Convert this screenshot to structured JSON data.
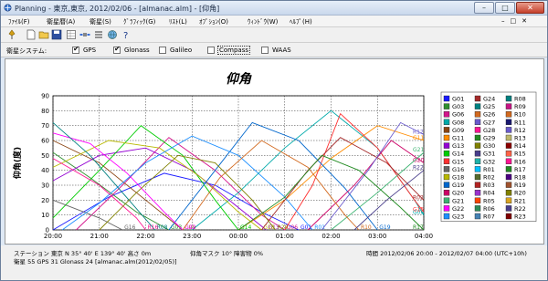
{
  "window": {
    "title": "Planning - 東京,東京, 2012/02/06 - [almanac.alm] - [仰角]",
    "min_label": "–",
    "max_label": "□",
    "close_label": "✕"
  },
  "menu": [
    "ﾌｧｲﾙ(F)",
    "衛星暦(A)",
    "衛星(S)",
    "ｸﾞﾗﾌｨｯｸ(G)",
    "ﾘｽﾄ(L)",
    "ｵﾌﾟｼｮﾝ(O)",
    "ｳｨﾝﾄﾞｳ(W)",
    "ﾍﾙﾌﾟ(H)"
  ],
  "toolbar_icons": [
    "pin-icon",
    "new-file-icon",
    "open-folder-icon",
    "save-icon",
    "sheet-icon",
    "satellite-icon",
    "list-icon",
    "globe-icon",
    "help-icon"
  ],
  "satellite_bar": {
    "label": "衛星システム:",
    "options": [
      {
        "name": "GPS",
        "checked": true
      },
      {
        "name": "Glonass",
        "checked": true
      },
      {
        "name": "Galileo",
        "checked": false
      },
      {
        "name": "Compass",
        "checked": false
      },
      {
        "name": "WAAS",
        "checked": false
      }
    ]
  },
  "chart_data": {
    "type": "line",
    "title": "仰角",
    "ylabel": "仰角(度)",
    "xlabel": "",
    "ylim": [
      0,
      90
    ],
    "yticks": [
      0,
      10,
      20,
      30,
      40,
      50,
      60,
      70,
      80,
      90
    ],
    "xticks": [
      "20:00",
      "21:00",
      "22:00",
      "23:00",
      "00:00",
      "01:00",
      "02:00",
      "03:00",
      "04:00"
    ],
    "grid": true,
    "legend_position": "right",
    "series": [
      {
        "name": "G01",
        "color": "#1a1aff",
        "points": [
          [
            0,
            0
          ],
          [
            1.2,
            22
          ],
          [
            2.4,
            38
          ],
          [
            3.5,
            30
          ],
          [
            4.5,
            12
          ],
          [
            5.3,
            0
          ]
        ]
      },
      {
        "name": "G03",
        "color": "#2f8f2f",
        "points": [
          [
            0,
            52
          ],
          [
            0.8,
            35
          ],
          [
            1.8,
            12
          ],
          [
            2.5,
            0
          ]
        ]
      },
      {
        "name": "G06",
        "color": "#d4148c",
        "points": [
          [
            0.5,
            0
          ],
          [
            1.5,
            30
          ],
          [
            2.5,
            62
          ],
          [
            3.5,
            40
          ],
          [
            4.5,
            10
          ],
          [
            5,
            0
          ]
        ]
      },
      {
        "name": "G08",
        "color": "#00aaaa",
        "points": [
          [
            3,
            0
          ],
          [
            4,
            25
          ],
          [
            5,
            55
          ],
          [
            6,
            80
          ],
          [
            7,
            55
          ],
          [
            7.8,
            20
          ],
          [
            8,
            10
          ]
        ]
      },
      {
        "name": "G09",
        "color": "#8b4513",
        "points": [
          [
            0,
            60
          ],
          [
            1,
            45
          ],
          [
            2,
            20
          ],
          [
            2.8,
            0
          ]
        ]
      },
      {
        "name": "G11",
        "color": "#ff8c00",
        "points": [
          [
            4,
            0
          ],
          [
            5,
            20
          ],
          [
            6,
            48
          ],
          [
            7,
            70
          ],
          [
            8,
            60
          ]
        ]
      },
      {
        "name": "G13",
        "color": "#9400d3",
        "points": [
          [
            0,
            33
          ],
          [
            1,
            50
          ],
          [
            2,
            55
          ],
          [
            3,
            40
          ],
          [
            4,
            15
          ],
          [
            4.6,
            0
          ]
        ]
      },
      {
        "name": "G14",
        "color": "#00cc00",
        "points": [
          [
            0,
            8
          ],
          [
            1,
            40
          ],
          [
            1.9,
            70
          ],
          [
            2.8,
            50
          ],
          [
            3.5,
            20
          ],
          [
            4,
            0
          ]
        ]
      },
      {
        "name": "G15",
        "color": "#ff3030",
        "points": [
          [
            5,
            0
          ],
          [
            5.6,
            30
          ],
          [
            6.2,
            78
          ],
          [
            7,
            55
          ],
          [
            7.8,
            20
          ],
          [
            8,
            12
          ]
        ]
      },
      {
        "name": "G16",
        "color": "#666666",
        "points": [
          [
            0,
            20
          ],
          [
            1,
            8
          ],
          [
            1.5,
            0
          ]
        ]
      },
      {
        "name": "G18",
        "color": "#b8b800",
        "points": [
          [
            0,
            42
          ],
          [
            1.2,
            60
          ],
          [
            2.3,
            55
          ],
          [
            3.2,
            35
          ],
          [
            4,
            12
          ],
          [
            4.5,
            0
          ]
        ]
      },
      {
        "name": "G19",
        "color": "#0066cc",
        "points": [
          [
            2.5,
            0
          ],
          [
            3.5,
            40
          ],
          [
            4.3,
            72
          ],
          [
            5.3,
            60
          ],
          [
            6.3,
            28
          ],
          [
            7,
            0
          ]
        ]
      },
      {
        "name": "G20",
        "color": "#cc0066",
        "points": [
          [
            5.5,
            0
          ],
          [
            6.5,
            30
          ],
          [
            7.3,
            60
          ],
          [
            8,
            45
          ]
        ]
      },
      {
        "name": "G21",
        "color": "#3cb371",
        "points": [
          [
            6,
            0
          ],
          [
            7,
            25
          ],
          [
            8,
            52
          ]
        ]
      },
      {
        "name": "G22",
        "color": "#ff00ff",
        "points": [
          [
            0,
            65
          ],
          [
            0.8,
            58
          ],
          [
            1.6,
            38
          ],
          [
            2.4,
            12
          ],
          [
            2.8,
            0
          ]
        ]
      },
      {
        "name": "R01",
        "color": "#1e90ff",
        "points": [
          [
            0.2,
            0
          ],
          [
            1,
            18
          ],
          [
            2,
            45
          ],
          [
            3,
            63
          ],
          [
            4,
            50
          ],
          [
            5,
            22
          ],
          [
            5.6,
            0
          ]
        ]
      },
      {
        "name": "R02",
        "color": "#a52a2a",
        "points": [
          [
            4.5,
            0
          ],
          [
            5.5,
            40
          ],
          [
            6.2,
            62
          ],
          [
            7.2,
            45
          ],
          [
            8,
            20
          ]
        ]
      },
      {
        "name": "R08",
        "color": "#008080",
        "points": [
          [
            0,
            72
          ],
          [
            0.8,
            50
          ],
          [
            1.5,
            25
          ],
          [
            2.2,
            0
          ]
        ]
      },
      {
        "name": "R10",
        "color": "#d2691e",
        "points": [
          [
            2.8,
            0
          ],
          [
            3.6,
            35
          ],
          [
            4.5,
            60
          ],
          [
            5.5,
            42
          ],
          [
            6.3,
            10
          ],
          [
            6.6,
            0
          ]
        ]
      },
      {
        "name": "R12",
        "color": "#6a5acd",
        "points": [
          [
            5.8,
            0
          ],
          [
            6.8,
            40
          ],
          [
            7.5,
            72
          ],
          [
            8,
            64
          ]
        ]
      },
      {
        "name": "R16",
        "color": "#ff1493",
        "points": [
          [
            0,
            48
          ],
          [
            1,
            30
          ],
          [
            1.8,
            8
          ],
          [
            2,
            0
          ]
        ]
      },
      {
        "name": "R17",
        "color": "#228b22",
        "points": [
          [
            4,
            0
          ],
          [
            5,
            22
          ],
          [
            5.8,
            50
          ],
          [
            6.6,
            40
          ],
          [
            7.5,
            15
          ],
          [
            8,
            0
          ]
        ]
      },
      {
        "name": "R20",
        "color": "#808000",
        "points": [
          [
            1,
            0
          ],
          [
            1.8,
            25
          ],
          [
            2.7,
            50
          ],
          [
            3.5,
            45
          ],
          [
            4.3,
            20
          ],
          [
            4.8,
            0
          ]
        ]
      },
      {
        "name": "R22",
        "color": "#483d8b",
        "points": [
          [
            6.5,
            0
          ],
          [
            7.2,
            20
          ],
          [
            8,
            40
          ]
        ]
      }
    ],
    "legend_entries": [
      "G01",
      "G03",
      "G06",
      "G08",
      "G09",
      "G11",
      "G13",
      "G14",
      "G15",
      "G16",
      "G18",
      "G19",
      "G20",
      "G21",
      "G22",
      "G23",
      "G24",
      "G25",
      "G26",
      "G27",
      "G28",
      "G29",
      "G30",
      "G31",
      "G32",
      "R01",
      "R02",
      "R03",
      "R04",
      "R05",
      "R06",
      "R07",
      "R08",
      "R09",
      "R10",
      "R11",
      "R12",
      "R13",
      "R14",
      "R15",
      "R16",
      "R17",
      "R18",
      "R19",
      "R20",
      "R21",
      "R22",
      "R23"
    ],
    "legend_colors": [
      "#1a1aff",
      "#2f8f2f",
      "#d4148c",
      "#00aaaa",
      "#8b4513",
      "#ff8c00",
      "#9400d3",
      "#00cc00",
      "#ff3030",
      "#666666",
      "#b8b800",
      "#0066cc",
      "#cc0066",
      "#3cb371",
      "#ff00ff",
      "#1e90ff",
      "#a52a2a",
      "#008080",
      "#d2691e",
      "#6a5acd",
      "#ff1493",
      "#228b22",
      "#808000",
      "#483d8b",
      "#20b2aa",
      "#00bfff",
      "#556b2f",
      "#b22222",
      "#9932cc",
      "#ff4500",
      "#2e8b57",
      "#4682b4",
      "#008080",
      "#c71585",
      "#d2691e",
      "#191970",
      "#6a5acd",
      "#bdb76b",
      "#8b0000",
      "#ff6347",
      "#ff1493",
      "#228b22",
      "#4b0082",
      "#a0522d",
      "#808000",
      "#daa520",
      "#483d8b",
      "#800000"
    ]
  },
  "status": {
    "station": "ステーション 東京 N 35° 40'  E 139° 40'  高さ 0m",
    "counts": "衛星 55  GPS 31  Glonass 24  [almanac.alm(2012/02/05)]",
    "mask": "仰角マスク 10°   障害物 0%",
    "time": "時間 2012/02/06 20:00 - 2012/02/07 04:00 (UTC+10h)"
  }
}
